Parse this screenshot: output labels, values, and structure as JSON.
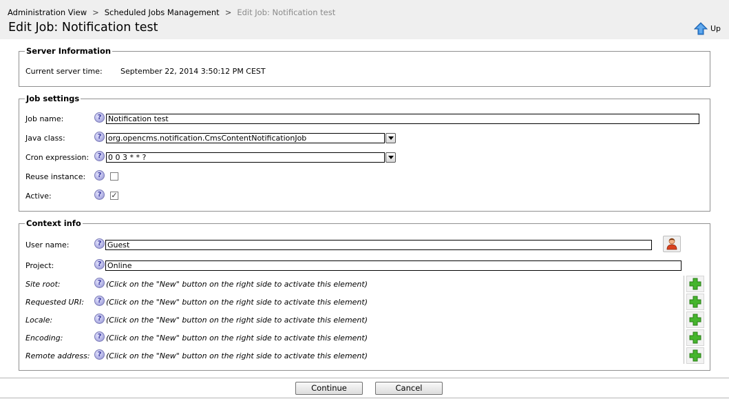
{
  "breadcrumb": {
    "items": [
      "Administration View",
      "Scheduled Jobs Management"
    ],
    "separator": ">",
    "current": "Edit Job: Notification test"
  },
  "page_title": "Edit Job: Notification test",
  "up_button": {
    "label": "Up",
    "icon": "up-arrow-icon"
  },
  "server_info": {
    "legend": "Server Information",
    "time_label": "Current server time:",
    "time_value": "September 22, 2014 3:50:12 PM CEST"
  },
  "job_settings": {
    "legend": "Job settings",
    "job_name_label": "Job name:",
    "job_name_value": "Notification test",
    "java_class_label": "Java class:",
    "java_class_value": "org.opencms.notification.CmsContentNotificationJob",
    "cron_label": "Cron expression:",
    "cron_value": "0 0 3 * * ?",
    "reuse_label": "Reuse instance:",
    "reuse_checked": false,
    "active_label": "Active:",
    "active_checked": true
  },
  "context_info": {
    "legend": "Context info",
    "user_label": "User name:",
    "user_value": "Guest",
    "project_label": "Project:",
    "project_value": "Online",
    "site_root_label": "Site root:",
    "requested_uri_label": "Requested URI:",
    "locale_label": "Locale:",
    "encoding_label": "Encoding:",
    "remote_address_label": "Remote address:",
    "inactive_hint": "(Click on the \"New\" button on the right side to activate this element)"
  },
  "help_glyph": "?",
  "check_glyph": "✓",
  "buttons": {
    "continue": "Continue",
    "cancel": "Cancel"
  },
  "colors": {
    "header_bg": "#efefef",
    "plus_green": "#3fae2a",
    "up_blue": "#2e7fd6"
  }
}
